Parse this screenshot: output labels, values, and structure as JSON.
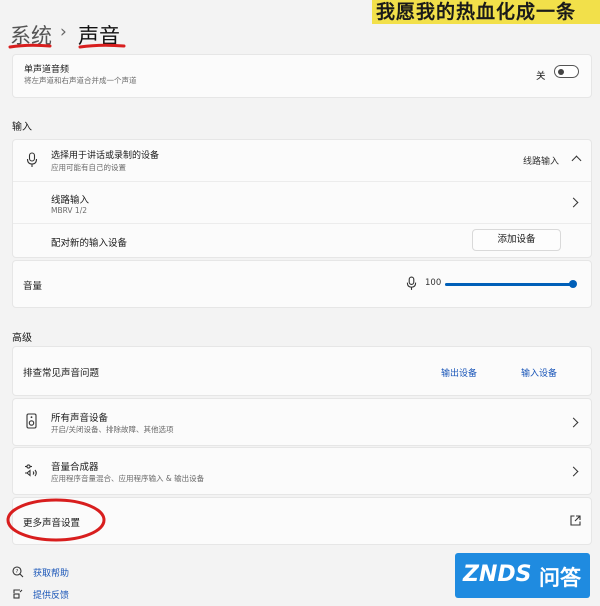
{
  "breadcrumb": {
    "parent": "系统",
    "separator": "›",
    "current": "声音"
  },
  "overlay_banner": "我愿我的热血化成一条",
  "mono": {
    "title": "单声道音频",
    "subtitle": "将左声道和右声道合并成一个声道",
    "toggle_label": "关",
    "toggle_on": false
  },
  "input_section": {
    "label": "输入",
    "device_select": {
      "title": "选择用于讲话或录制的设备",
      "subtitle": "应用可能有自己的设置",
      "value": "线路输入"
    },
    "line_in": {
      "title": "线路输入",
      "subtitle": "MBRV 1/2"
    },
    "pair": {
      "label": "配对新的输入设备",
      "button": "添加设备"
    },
    "volume": {
      "label": "音量",
      "value": "100",
      "level": 1.0
    }
  },
  "advanced_section": {
    "label": "高级",
    "troubleshoot": {
      "label": "排查常见声音问题",
      "output_link": "输出设备",
      "input_link": "输入设备"
    },
    "all_devices": {
      "title": "所有声音设备",
      "subtitle": "开启/关闭设备、排除故障、其他选项"
    },
    "mixer": {
      "title": "音量合成器",
      "subtitle": "应用程序音量混合、应用程序输入 & 输出设备"
    },
    "more_settings": {
      "label": "更多声音设置"
    }
  },
  "footer": {
    "help": "获取帮助",
    "feedback": "提供反馈"
  },
  "watermark": {
    "brand": "ZNDS",
    "suffix": "问答"
  },
  "colors": {
    "accent": "#005fb8",
    "annotation_red": "#d81e1e"
  }
}
